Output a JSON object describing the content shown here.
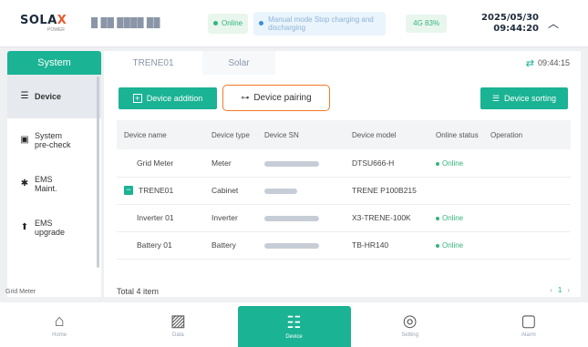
{
  "header": {
    "brand_main": "SOLA",
    "brand_x": "X",
    "brand_sub": "POWER",
    "device_name": "█ ██ ████ ██",
    "online_label": "Online",
    "mode_text": "Manual mode Stop charging and discharging",
    "signal_label": "4G 83%",
    "date": "2025/05/30",
    "time": "09:44:20"
  },
  "sidebar": {
    "header": "System",
    "items": [
      {
        "label": "Device",
        "icon": "device-list-icon"
      },
      {
        "label": "System\npre-check",
        "icon": "monitor-check-icon"
      },
      {
        "label": "EMS\nMaint.",
        "icon": "tools-icon"
      },
      {
        "label": "EMS\nupgrade",
        "icon": "upgrade-icon"
      }
    ],
    "cut_label": "Grid Meter"
  },
  "tabs": [
    {
      "label": "TRENE01"
    },
    {
      "label": "Solar"
    }
  ],
  "sync_time": "09:44:15",
  "toolbar": {
    "add_label": "Device addition",
    "pair_label": "Device pairing",
    "sort_label": "Device sorting"
  },
  "table": {
    "headers": [
      "Device name",
      "Device type",
      "Device SN",
      "Device model",
      "Online status",
      "Operation"
    ],
    "rows": [
      {
        "name": "Grid Meter",
        "type": "Meter",
        "model": "DTSU666-H",
        "status": "Online"
      },
      {
        "name": "TRENE01",
        "type": "Cabinet",
        "model": "TRENE P100B215",
        "status": ""
      },
      {
        "name": "Inverter 01",
        "type": "Inverter",
        "model": "X3-TRENE-100K",
        "status": "Online"
      },
      {
        "name": "Battery 01",
        "type": "Battery",
        "model": "TB-HR140",
        "status": "Online"
      }
    ]
  },
  "footer": {
    "total": "Total 4 item",
    "page": "1"
  },
  "bottom_nav": [
    {
      "label": "Home",
      "icon": "home-icon"
    },
    {
      "label": "Data",
      "icon": "chart-icon"
    },
    {
      "label": "Device",
      "icon": "device-icon"
    },
    {
      "label": "Setting",
      "icon": "settings-icon"
    },
    {
      "label": "Alarm",
      "icon": "alarm-icon"
    }
  ],
  "colors": {
    "accent": "#1ab394",
    "highlight_border": "#f07a2a",
    "online": "#36b37e"
  }
}
